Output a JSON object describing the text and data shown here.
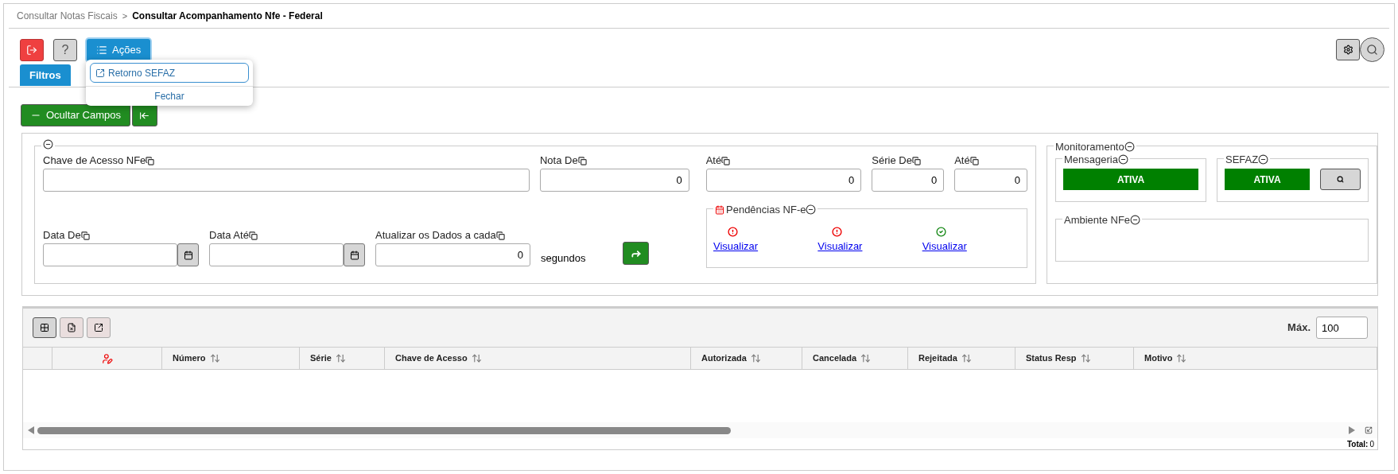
{
  "breadcrumb": {
    "separator": ">",
    "items": [
      {
        "label": "Consultar Notas Fiscais",
        "current": false
      },
      {
        "label": "Consultar Acompanhamento Nfe - Federal",
        "current": true
      }
    ]
  },
  "toolbar": {
    "help": "?",
    "actions": "Ações",
    "filters_tab": "Filtros"
  },
  "actions_menu": {
    "items": [
      {
        "label": "Retorno SEFAZ",
        "focused": true
      }
    ],
    "close": "Fechar"
  },
  "hide_fields_button": "Ocultar Campos",
  "filters": {
    "row1": [
      {
        "label": "Chave de Acesso NFe",
        "kind": "text"
      },
      {
        "label": "Nota De",
        "kind": "number",
        "value": "0"
      },
      {
        "label": "Até",
        "kind": "number",
        "value": "0"
      },
      {
        "label": "Série De",
        "kind": "number",
        "value": "0"
      },
      {
        "label": "Até",
        "kind": "number",
        "value": "0"
      }
    ],
    "row2": [
      {
        "label": "Data De",
        "kind": "date"
      },
      {
        "label": "Data Até",
        "kind": "date"
      },
      {
        "label": "Atualizar os Dados a cada",
        "kind": "number",
        "value": "0"
      }
    ],
    "unit": "segundos",
    "pending": {
      "title": "Pendências NF-e",
      "links": [
        {
          "label": "Visualizar",
          "kind": "error"
        },
        {
          "label": "Visualizar",
          "kind": "error"
        },
        {
          "label": "Visualizar",
          "kind": "ok"
        }
      ]
    }
  },
  "monitoring": {
    "title": "Monitoramento",
    "messaging": {
      "title": "Mensageria",
      "status": "ATIVA"
    },
    "sefaz": {
      "title": "SEFAZ",
      "status": "ATIVA"
    },
    "environment": {
      "title": "Ambiente NFe"
    }
  },
  "table": {
    "max_label": "Máx.",
    "max_value": "100",
    "columns": [
      {
        "kind": "blank"
      },
      {
        "kind": "icon"
      },
      {
        "kind": "sort",
        "label": "Número"
      },
      {
        "kind": "sort",
        "label": "Série"
      },
      {
        "kind": "sort",
        "label": "Chave de Acesso"
      },
      {
        "kind": "sort",
        "label": "Autorizada"
      },
      {
        "kind": "sort",
        "label": "Cancelada"
      },
      {
        "kind": "sort",
        "label": "Rejeitada"
      },
      {
        "kind": "sort",
        "label": "Status Resp"
      },
      {
        "kind": "sort",
        "label": "Motivo"
      }
    ],
    "total_label": "Total:",
    "total": "0"
  }
}
